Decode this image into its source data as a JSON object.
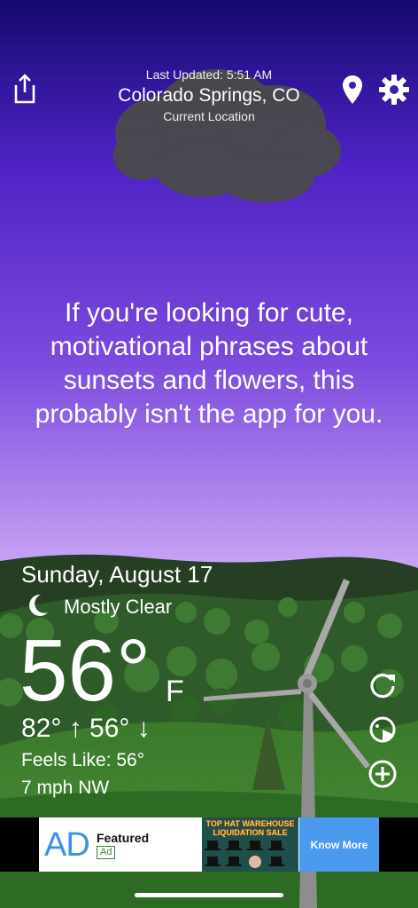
{
  "header": {
    "last_updated": "Last Updated: 5:51 AM",
    "city": "Colorado Springs, CO",
    "location_label": "Current Location",
    "icons": [
      "share-icon",
      "location-pin-icon",
      "gear-icon"
    ]
  },
  "phrase": "If you're looking for cute, motivational phrases about sunsets and flowers, this probably isn't the app for you.",
  "weather": {
    "date": "Sunday, August 17",
    "condition": "Mostly Clear",
    "condition_icon": "moon-icon",
    "temperature": "56°",
    "unit": "F",
    "high_low": "82° ↑ 56° ↓",
    "feels_like": "Feels Like: 56°",
    "wind": "7 mph NW"
  },
  "side_buttons": [
    "refresh-icon",
    "radar-icon",
    "add-icon"
  ],
  "ad": {
    "logo": "AD",
    "featured": "Featured",
    "tag": "Ad",
    "image_title": "TOP HAT WAREHOUSE LIQUIDATION SALE",
    "cta": "Know More"
  },
  "colors": {
    "sky_top": "#1a0f7a",
    "sky_mid": "#6a3ad6",
    "sky_bottom": "#c8a4f2",
    "hills": "#2f5a2a",
    "ad_accent": "#4a9af0"
  }
}
